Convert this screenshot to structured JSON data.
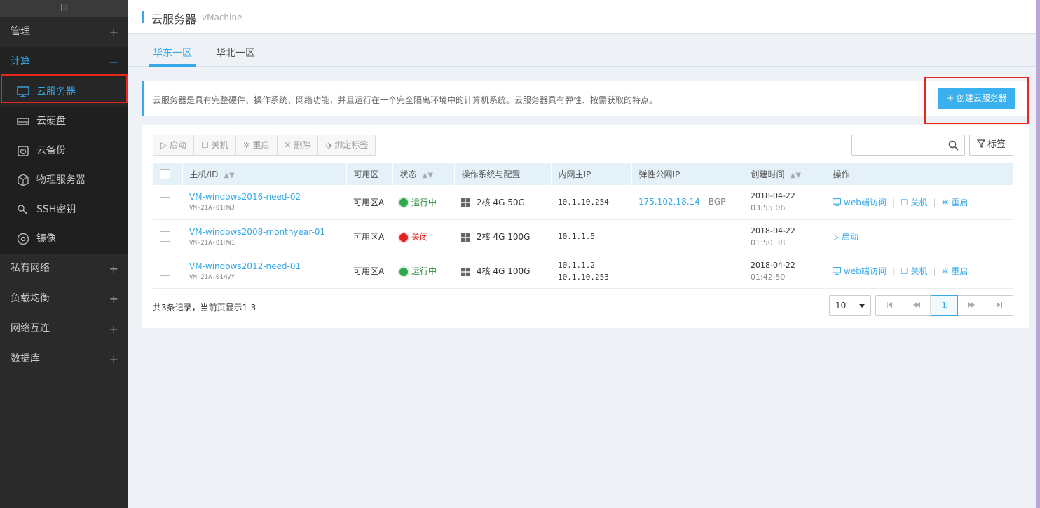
{
  "sidebar": {
    "top_handle": "III",
    "groups": [
      {
        "label": "管理",
        "toggle": "+"
      },
      {
        "label": "计算",
        "toggle": "−"
      },
      {
        "label": "私有网络",
        "toggle": "+"
      },
      {
        "label": "负载均衡",
        "toggle": "+"
      },
      {
        "label": "网络互连",
        "toggle": "+"
      },
      {
        "label": "数据库",
        "toggle": "+"
      }
    ],
    "compute_items": [
      {
        "label": "云服务器",
        "icon": "monitor-icon"
      },
      {
        "label": "云硬盘",
        "icon": "disk-icon"
      },
      {
        "label": "云备份",
        "icon": "backup-icon"
      },
      {
        "label": "物理服务器",
        "icon": "physical-server-icon"
      },
      {
        "label": "SSH密钥",
        "icon": "key-icon"
      },
      {
        "label": "镜像",
        "icon": "image-disc-icon"
      }
    ]
  },
  "header": {
    "title": "云服务器",
    "subtitle": "vMachine"
  },
  "tabs": [
    {
      "label": "华东一区"
    },
    {
      "label": "华北一区"
    }
  ],
  "info": {
    "text": "云服务器是具有完整硬件、操作系统、网络功能，并且运行在一个完全隔离环境中的计算机系统。云服务器具有弹性、按需获取的特点。",
    "create_button": "+ 创建云服务器"
  },
  "toolbar": {
    "start": "▷ 启动",
    "stop": "☐ 关机",
    "restart": "✲ 重启",
    "delete": "✕ 删除",
    "bind_tag": "⬗ 绑定标签",
    "search_placeholder": "",
    "tag_button": "标签"
  },
  "table": {
    "headers": {
      "host": "主机/ID",
      "zone": "可用区",
      "status": "状态",
      "os": "操作系统与配置",
      "ip": "内网主IP",
      "eip": "弹性公网IP",
      "created": "创建时间",
      "ops": "操作"
    },
    "rows": [
      {
        "name": "VM-windows2016-need-02",
        "id": "VM-21A-01HWJ",
        "zone": "可用区A",
        "status": "运行中",
        "config": "2核 4G 50G",
        "ip1": "10.1.10.254",
        "ip2": "",
        "eip": "175.102.18.14",
        "eip_line": " - BGP",
        "date": "2018-04-22",
        "time": "03:55:06"
      },
      {
        "name": "VM-windows2008-monthyear-01",
        "id": "VM-21A-01HW1",
        "zone": "可用区A",
        "status": "关闭",
        "config": "2核 4G 100G",
        "ip1": "10.1.1.5",
        "ip2": "",
        "eip": "",
        "eip_line": "",
        "date": "2018-04-22",
        "time": "01:50:38"
      },
      {
        "name": "VM-windows2012-need-01",
        "id": "VM-21A-01HVY",
        "zone": "可用区A",
        "status": "运行中",
        "config": "4核 4G 100G",
        "ip1": "10.1.1.2",
        "ip2": "10.1.10.253",
        "eip": "",
        "eip_line": "",
        "date": "2018-04-22",
        "time": "01:42:50"
      }
    ],
    "ops": {
      "web": "web端访问",
      "stop": "关机",
      "restart": "重启",
      "start": "启动"
    }
  },
  "footer": {
    "summary": "共3条记录，当前页显示1-3",
    "page_size": "10",
    "current_page": "1"
  }
}
